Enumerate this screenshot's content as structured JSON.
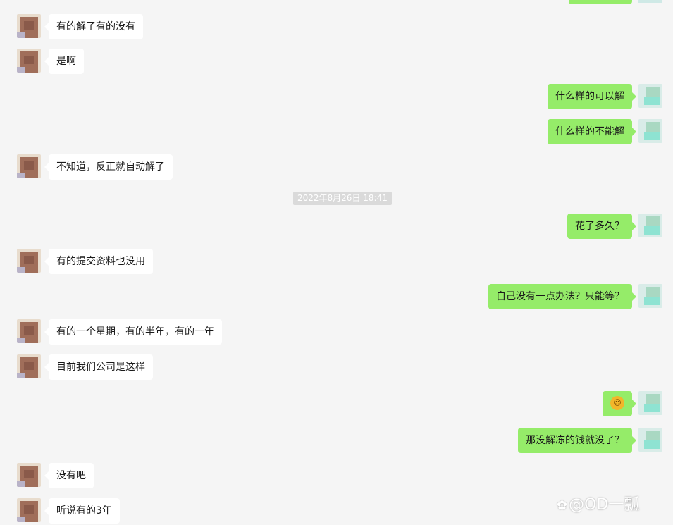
{
  "colors": {
    "background": "#f5f5f5",
    "incoming_bubble": "#ffffff",
    "outgoing_bubble": "#95ec69",
    "timestamp_bg": "#dadada"
  },
  "messages": [
    {
      "side": "left",
      "text": "有的解了有的没有"
    },
    {
      "side": "left",
      "text": "是啊"
    },
    {
      "side": "right",
      "text": "什么样的可以解"
    },
    {
      "side": "right",
      "text": "什么样的不能解"
    },
    {
      "side": "left",
      "text": "不知道，反正就自动解了"
    },
    {
      "side": "timestamp",
      "text": "2022年8月26日 18:41"
    },
    {
      "side": "right",
      "text": "花了多久？"
    },
    {
      "side": "left",
      "text": "有的提交资料也没用"
    },
    {
      "side": "right",
      "text": "自己没有一点办法？只能等？"
    },
    {
      "side": "left",
      "text": "有的一个星期，有的半年，有的一年"
    },
    {
      "side": "left",
      "text": "目前我们公司是这样"
    },
    {
      "side": "right",
      "emoji": "laughing-crying-emoji"
    },
    {
      "side": "right",
      "text": "那没解冻的钱就没了？"
    },
    {
      "side": "left",
      "text": "没有吧"
    },
    {
      "side": "left",
      "text": "听说有的3年"
    }
  ],
  "watermark": {
    "text": "@OD一瓢"
  }
}
